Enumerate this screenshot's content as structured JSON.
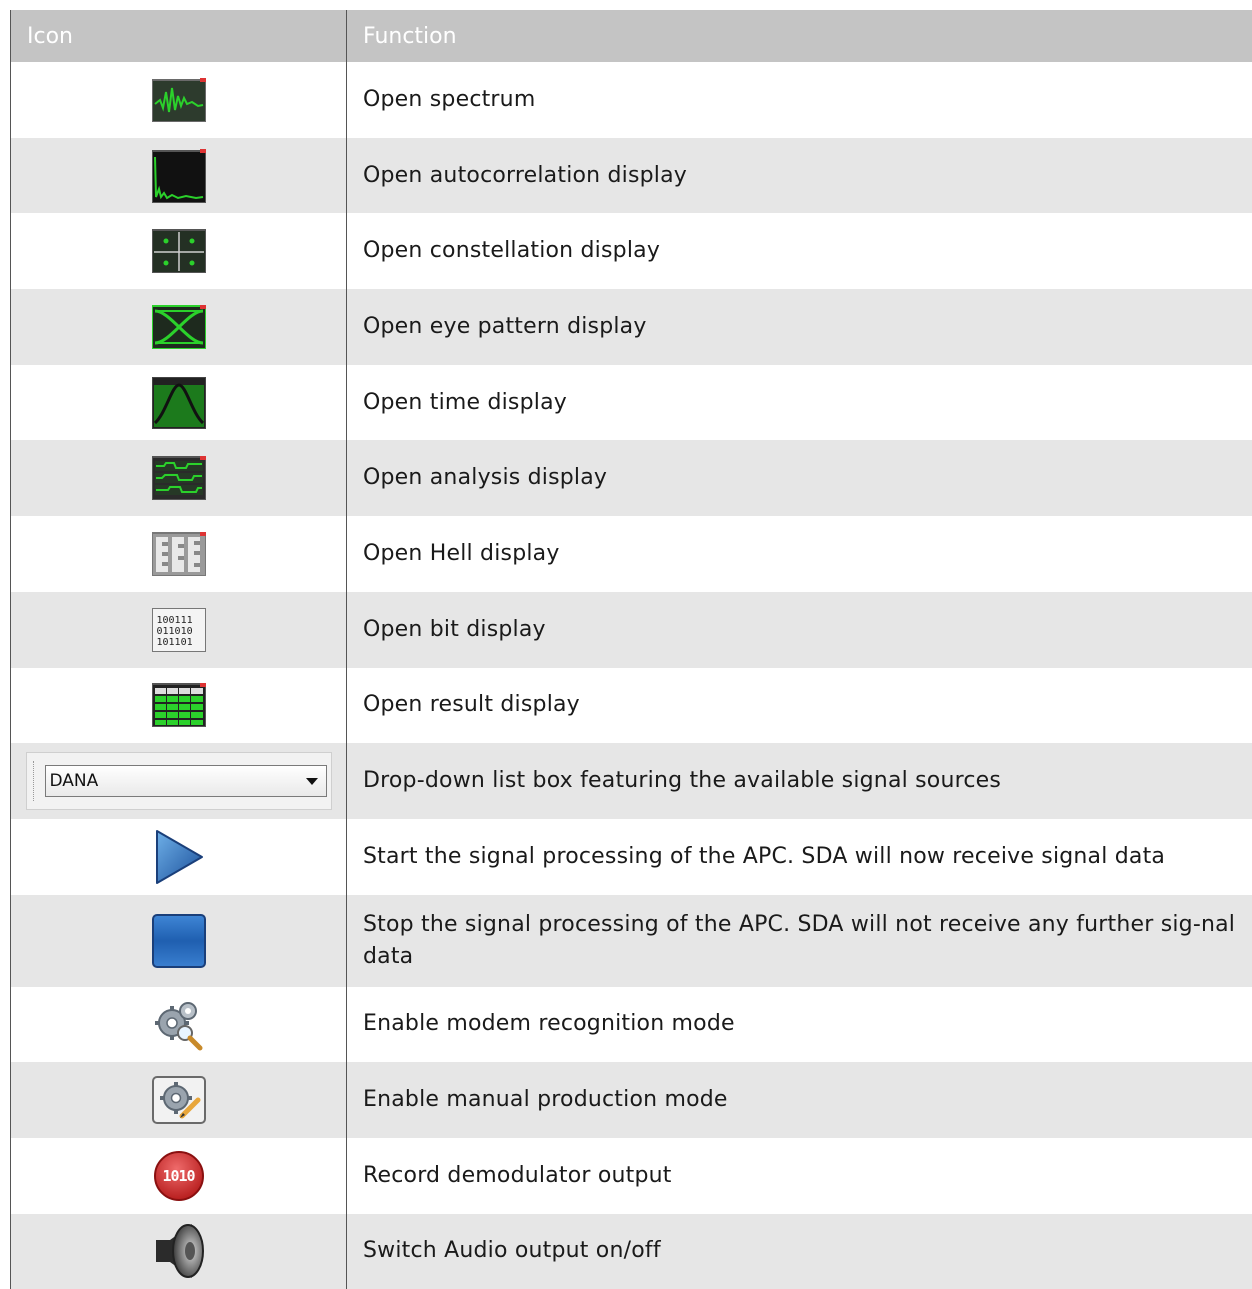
{
  "header": {
    "col_icon": "Icon",
    "col_function": "Function"
  },
  "rows": [
    {
      "icon": "spectrum-icon",
      "text": "Open spectrum"
    },
    {
      "icon": "autocorrelation-icon",
      "text": "Open autocorrelation display"
    },
    {
      "icon": "constellation-icon",
      "text": "Open constellation display"
    },
    {
      "icon": "eye-pattern-icon",
      "text": "Open eye pattern display"
    },
    {
      "icon": "time-display-icon",
      "text": "Open time display"
    },
    {
      "icon": "analysis-display-icon",
      "text": "Open analysis display"
    },
    {
      "icon": "hell-display-icon",
      "text": "Open Hell display"
    },
    {
      "icon": "bit-display-icon",
      "text": "Open bit display",
      "bits": [
        "100111",
        "011010",
        "101101"
      ]
    },
    {
      "icon": "result-display-icon",
      "text": "Open result display"
    },
    {
      "icon": "signal-source-dropdown",
      "text": "Drop-down list box featuring the available signal sources",
      "dropdown_value": "DANA"
    },
    {
      "icon": "play-icon",
      "text": "Start the signal processing of the APC. SDA will now receive signal data"
    },
    {
      "icon": "stop-icon",
      "text": "Stop the signal processing of the APC. SDA will not receive any further sig-nal data"
    },
    {
      "icon": "modem-recognition-icon",
      "text": "Enable modem recognition mode"
    },
    {
      "icon": "manual-production-icon",
      "text": "Enable manual production mode"
    },
    {
      "icon": "record-icon",
      "text": "Record demodulator output",
      "record_label": "1010"
    },
    {
      "icon": "speaker-icon",
      "text": "Switch Audio output on/off"
    }
  ],
  "colors": {
    "header_bg": "#c4c4c4",
    "alt_row_bg": "#e6e6e6",
    "icon_green": "#2bd12b"
  }
}
